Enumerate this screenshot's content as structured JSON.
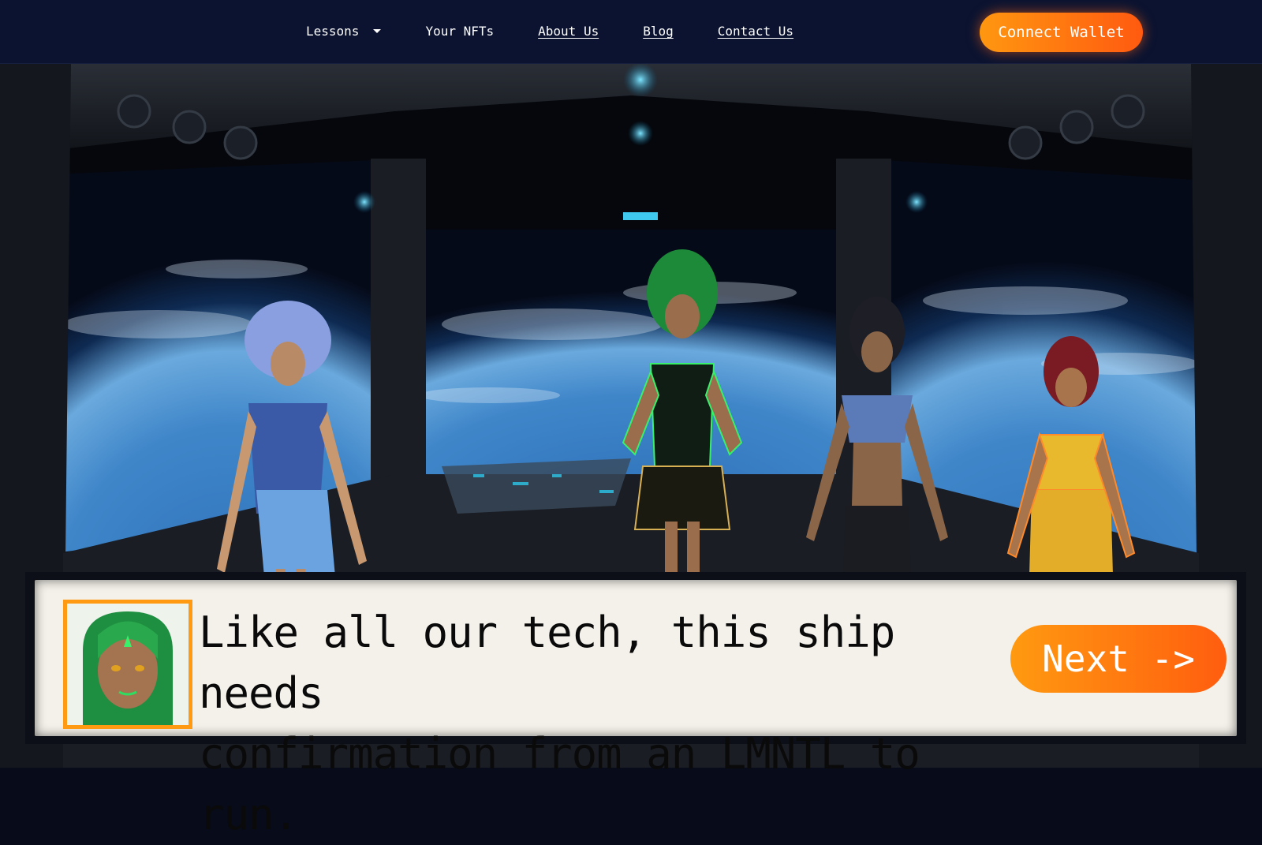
{
  "nav": {
    "items": [
      {
        "label": "Lessons"
      },
      {
        "label": "Your NFTs"
      },
      {
        "label": "About Us"
      },
      {
        "label": "Blog"
      },
      {
        "label": "Contact Us"
      }
    ],
    "connect_label": "Connect Wallet"
  },
  "scene": {
    "description_icons": [
      "spaceship-cockpit",
      "earth-view",
      "character-blue",
      "character-green",
      "character-silver",
      "character-gold"
    ]
  },
  "dialog": {
    "line1": "Like all our tech, this ship needs",
    "line2": "confirmation from an LMNTL to run.",
    "next_label": "Next ->"
  },
  "colors": {
    "accent_orange": "#ff9a12",
    "nav_bg": "#0b1330",
    "dialog_bg": "#f4f1ea"
  }
}
